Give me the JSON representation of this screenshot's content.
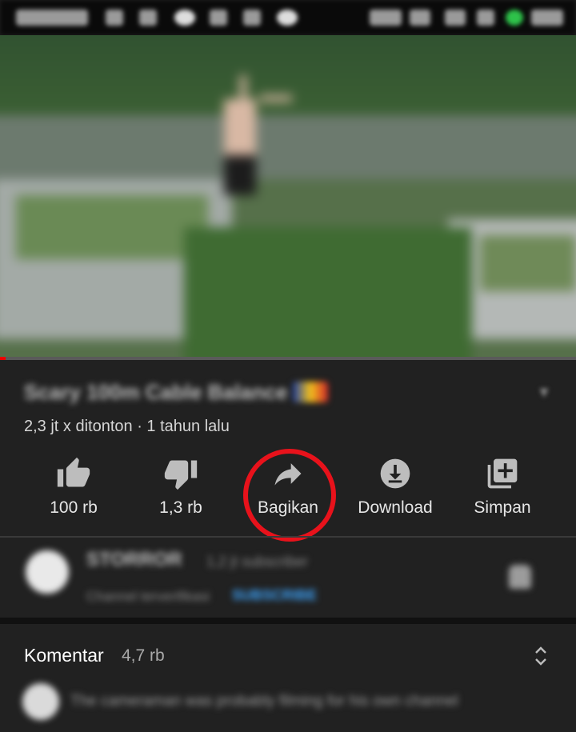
{
  "status_bar": {
    "carrier": "TELKOMSEL",
    "battery": "96%",
    "time": "08:15"
  },
  "video": {
    "progress": 0.01
  },
  "title": {
    "text": "Scary 100m Cable Balance"
  },
  "meta": {
    "views_time": "2,3 jt x ditonton · 1 tahun lalu"
  },
  "actions": [
    {
      "label": "100 rb",
      "icon": "thumb-up-icon"
    },
    {
      "label": "1,3 rb",
      "icon": "thumb-down-icon"
    },
    {
      "label": "Bagikan",
      "icon": "share-icon"
    },
    {
      "label": "Download",
      "icon": "download-icon"
    },
    {
      "label": "Simpan",
      "icon": "add-to-playlist-icon"
    }
  ],
  "channel": {
    "name": "STORROR",
    "subscribers": "1,2 jt subscriber",
    "note": "Channel terverifikasi",
    "subscribe_label": "SUBSCRIBE"
  },
  "comments": {
    "label": "Komentar",
    "count": "4,7 rb",
    "first_comment": "The cameraman was probably filming for his own channel"
  },
  "colors": {
    "highlight": "#e8121b",
    "background": "#212121",
    "accent": "#3ea6ff"
  }
}
